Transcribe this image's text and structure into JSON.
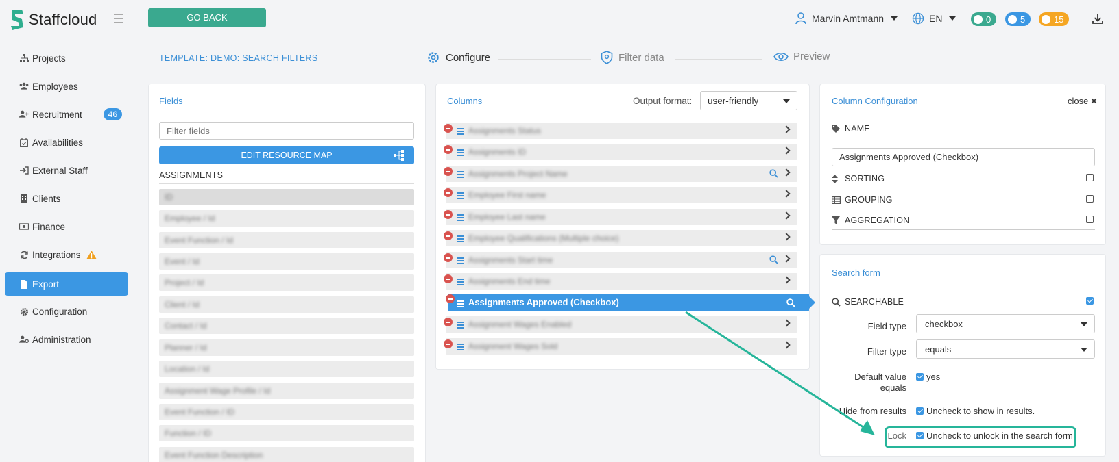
{
  "app": {
    "name": "Staffcloud",
    "go_back": "GO BACK"
  },
  "header": {
    "user_name": "Marvin Amtmann",
    "language": "EN",
    "counters": [
      {
        "icon": "chat-icon",
        "value": "0",
        "color": "#3aa98f"
      },
      {
        "icon": "bell-icon",
        "value": "5",
        "color": "#3b97e3"
      },
      {
        "icon": "clock-icon",
        "value": "15",
        "color": "#f5a623"
      }
    ]
  },
  "sidebar": {
    "items": [
      {
        "label": "Projects",
        "icon": "sitemap-icon"
      },
      {
        "label": "Employees",
        "icon": "users-icon"
      },
      {
        "label": "Recruitment",
        "icon": "user-plus-icon",
        "badge": "46"
      },
      {
        "label": "Availabilities",
        "icon": "calendar-check-icon"
      },
      {
        "label": "External Staff",
        "icon": "sign-in-icon"
      },
      {
        "label": "Clients",
        "icon": "building-icon"
      },
      {
        "label": "Finance",
        "icon": "money-icon"
      },
      {
        "label": "Integrations",
        "icon": "sync-icon",
        "warning": true
      },
      {
        "label": "Export",
        "icon": "file-icon",
        "active": true
      },
      {
        "label": "Configuration",
        "icon": "gear-icon"
      },
      {
        "label": "Administration",
        "icon": "user-cog-icon"
      }
    ]
  },
  "template_title": "TEMPLATE: DEMO: SEARCH FILTERS",
  "steps": [
    {
      "label": "Configure",
      "icon": "gear-icon",
      "active": true
    },
    {
      "label": "Filter data",
      "icon": "shield-icon",
      "active": false
    },
    {
      "label": "Preview",
      "icon": "eye-icon",
      "active": false
    }
  ],
  "fields_panel": {
    "title": "Fields",
    "filter_placeholder": "Filter fields",
    "edit_resource_map": "EDIT RESOURCE MAP",
    "section": "ASSIGNMENTS",
    "rows": [
      "ID",
      "Employee / Id",
      "Event Function / Id",
      "Event / Id",
      "Project / Id",
      "Client / Id",
      "Contact / Id",
      "Planner / Id",
      "Location / Id",
      "Assignment Wage Profile / Id",
      "Event Function / ID",
      "Function / ID",
      "Event Function Description"
    ]
  },
  "columns_panel": {
    "title": "Columns",
    "output_format_label": "Output format:",
    "output_format_value": "user-friendly",
    "rows": [
      {
        "label": "Assignments Status",
        "search": false
      },
      {
        "label": "Assignments ID",
        "search": false
      },
      {
        "label": "Assignments Project Name",
        "search": true
      },
      {
        "label": "Employee First name",
        "search": false
      },
      {
        "label": "Employee Last name",
        "search": false
      },
      {
        "label": "Employee Qualifications (Multiple choice)",
        "search": false
      },
      {
        "label": "Assignments Start time",
        "search": true
      },
      {
        "label": "Assignments End time",
        "search": false
      },
      {
        "label": "Assignments Approved (Checkbox)",
        "search": true,
        "active": true
      },
      {
        "label": "Assignment Wages Enabled",
        "search": false
      },
      {
        "label": "Assignment Wages Sold",
        "search": false
      }
    ]
  },
  "config_panel": {
    "title": "Column Configuration",
    "close": "close",
    "name_label": "NAME",
    "name_value": "Assignments Approved (Checkbox)",
    "sorting_label": "SORTING",
    "grouping_label": "GROUPING",
    "aggregation_label": "AGGREGATION",
    "sorting_checked": false,
    "grouping_checked": false,
    "aggregation_checked": false
  },
  "search_form": {
    "title": "Search form",
    "searchable_label": "SEARCHABLE",
    "searchable_checked": true,
    "field_type_label": "Field type",
    "field_type_value": "checkbox",
    "filter_type_label": "Filter type",
    "filter_type_value": "equals",
    "default_value_label_1": "Default value",
    "default_value_label_2": "equals",
    "default_value_text": "yes",
    "hide_label": "Hide from results",
    "hide_text": "Uncheck to show in results.",
    "lock_label": "Lock",
    "lock_text": "Uncheck to unlock in the search form."
  }
}
